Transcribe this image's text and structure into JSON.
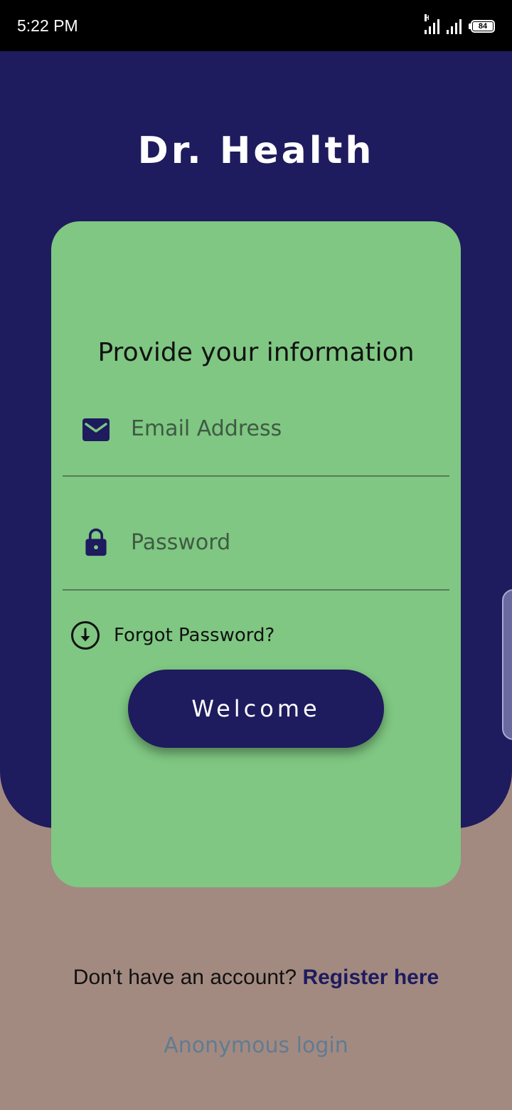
{
  "status_bar": {
    "time": "5:22 PM",
    "network_label": "H",
    "battery_level": "84"
  },
  "app": {
    "title": "Dr. Health"
  },
  "form": {
    "heading": "Provide your information",
    "email_placeholder": "Email Address",
    "password_placeholder": "Password",
    "forgot_label": "Forgot Password?",
    "submit_label": "Welcome"
  },
  "footer": {
    "register_prompt": "Don't have an account?",
    "register_link": "Register here",
    "anonymous_login": "Anonymous login"
  },
  "icons": {
    "email": "mail-icon",
    "password": "lock-icon",
    "forgot": "arrow-down-circle-icon"
  },
  "colors": {
    "primary": "#1e1b5e",
    "card": "#7fc782",
    "background": "#a38a80",
    "anonymous_link": "#617b91"
  }
}
